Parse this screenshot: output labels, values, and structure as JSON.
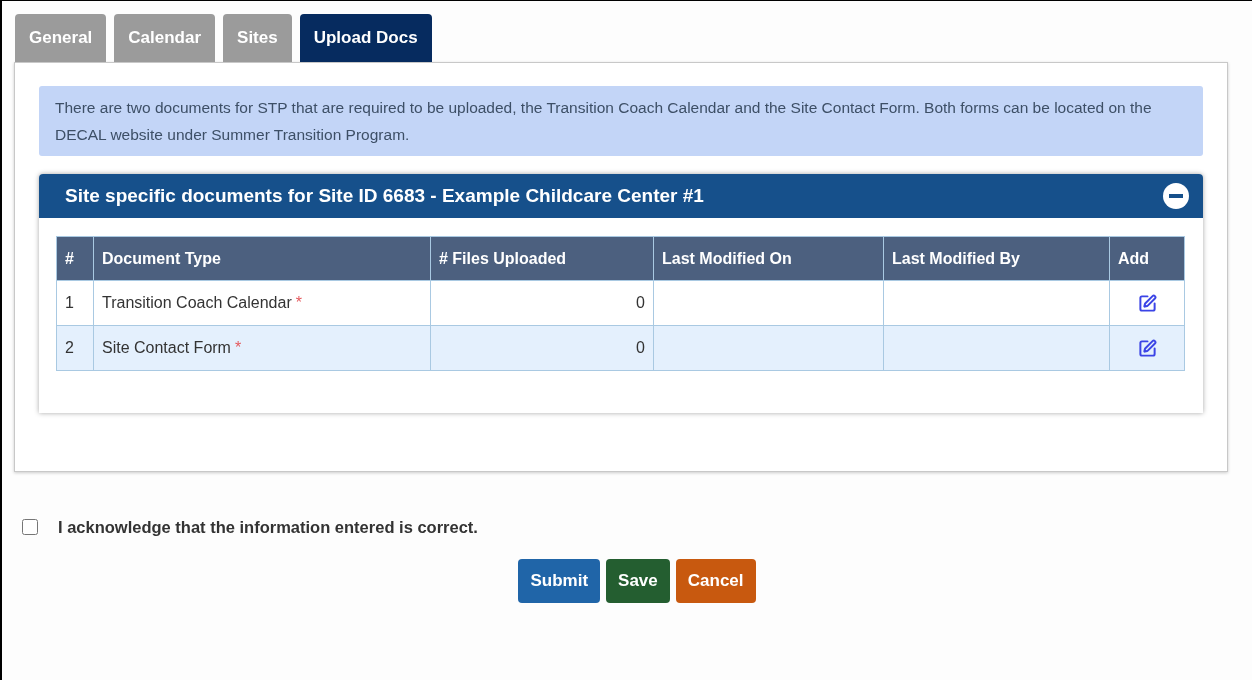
{
  "tabs": [
    {
      "label": "General",
      "selected": false
    },
    {
      "label": "Calendar",
      "selected": false
    },
    {
      "label": "Sites",
      "selected": false
    },
    {
      "label": "Upload Docs",
      "selected": true
    }
  ],
  "info_text": "There are two documents for STP that are required to be uploaded, the Transition Coach Calendar and the Site Contact Form. Both forms can be located on the DECAL website under Summer Transition Program.",
  "panel": {
    "title": "Site specific documents for Site ID 6683 - Example Childcare Center #1",
    "expanded": true,
    "table": {
      "columns": [
        "#",
        "Document Type",
        "# Files Uploaded",
        "Last Modified On",
        "Last Modified By",
        "Add"
      ],
      "rows": [
        {
          "number": "1",
          "document_type": "Transition Coach Calendar",
          "required_mark": "*",
          "files_uploaded": "0"
        },
        {
          "number": "2",
          "document_type": "Site Contact Form",
          "required_mark": "*",
          "files_uploaded": "0"
        }
      ]
    }
  },
  "acknowledge": {
    "label": "I acknowledge that the information entered is correct.",
    "checked": false
  },
  "buttons": [
    {
      "label": "Submit",
      "kind": "primary"
    },
    {
      "label": "Save",
      "kind": "success"
    },
    {
      "label": "Cancel",
      "kind": "danger"
    }
  ]
}
